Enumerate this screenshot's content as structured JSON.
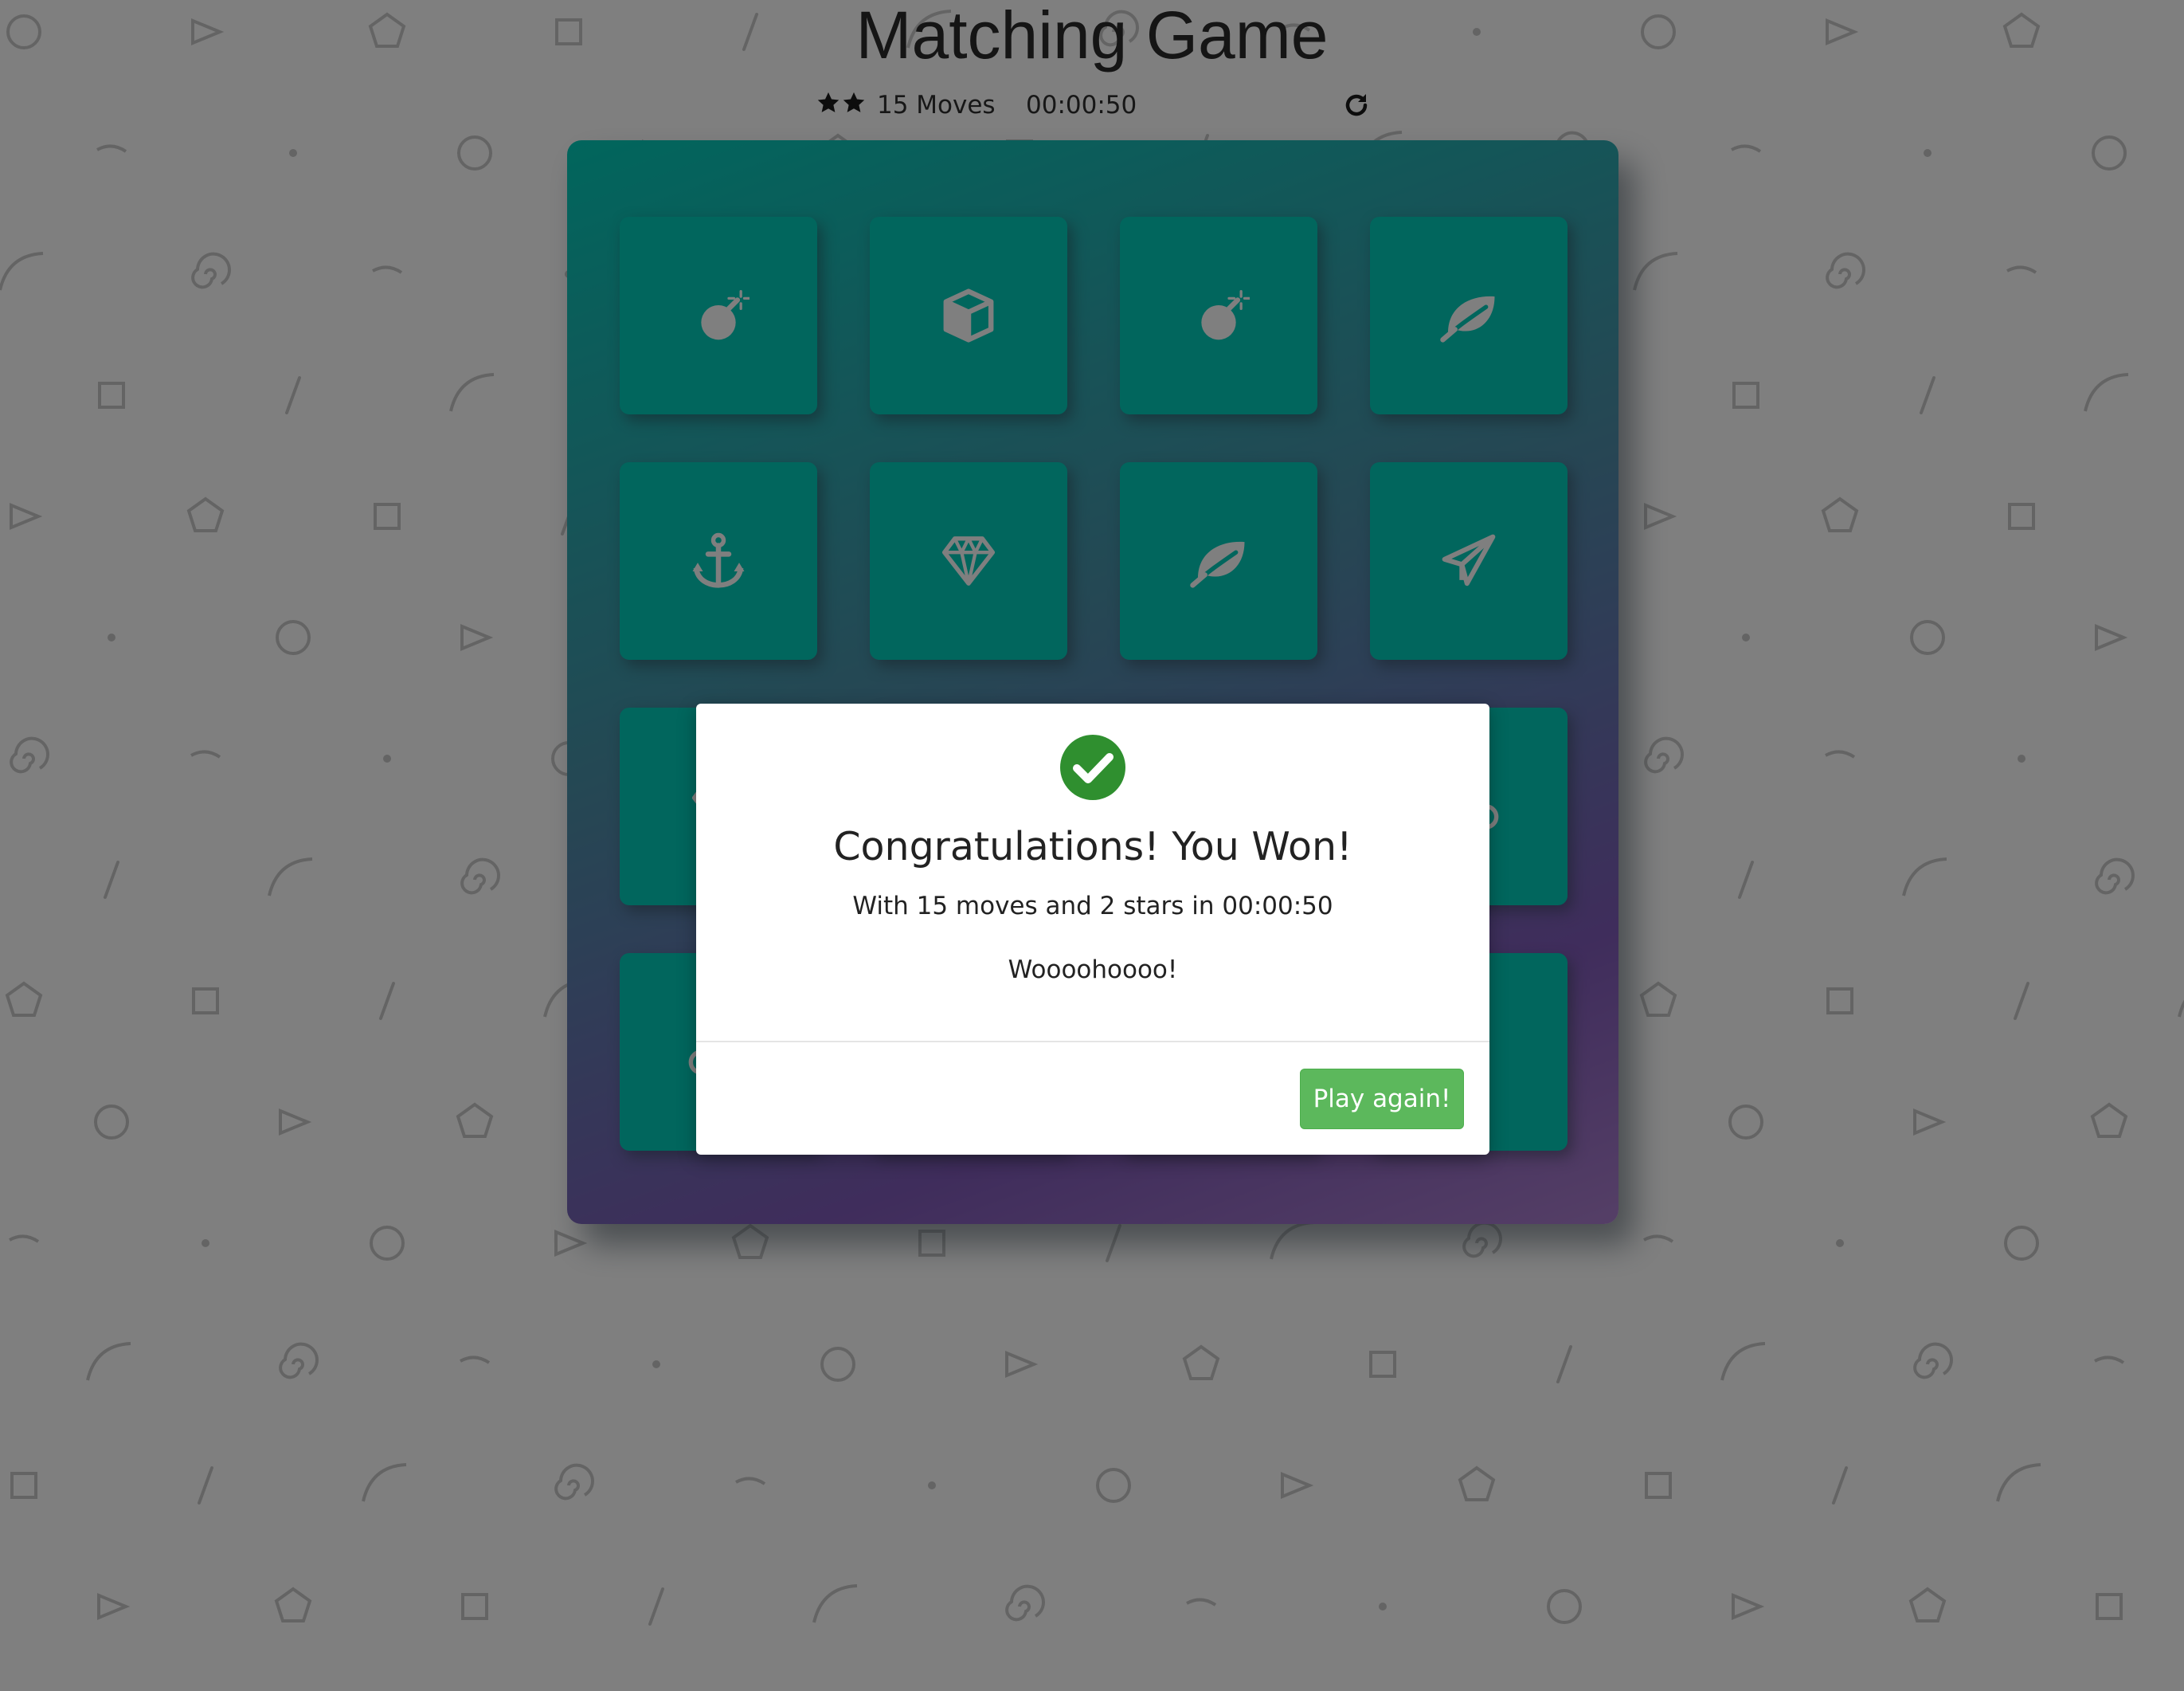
{
  "page": {
    "title": "Matching Game"
  },
  "score_panel": {
    "stars": 2,
    "star_icon": "star-icon",
    "moves_label": "15 Moves",
    "timer": "00:00:50",
    "restart_icon": "repeat-icon"
  },
  "deck": {
    "colors": {
      "open": "#02b3e4",
      "match": "#02ccba"
    },
    "cards": [
      {
        "icon": "bomb-icon",
        "state": "match"
      },
      {
        "icon": "cube-icon",
        "state": "match"
      },
      {
        "icon": "bomb-icon",
        "state": "match"
      },
      {
        "icon": "leaf-icon",
        "state": "match"
      },
      {
        "icon": "anchor-icon",
        "state": "match"
      },
      {
        "icon": "diamond-icon",
        "state": "match"
      },
      {
        "icon": "leaf-icon",
        "state": "match"
      },
      {
        "icon": "paper-plane-icon",
        "state": "match"
      },
      {
        "icon": "diamond-icon",
        "state": "match"
      },
      {
        "icon": "hidden-card",
        "state": "match"
      },
      {
        "icon": "hidden-card",
        "state": "match"
      },
      {
        "icon": "bicycle-icon",
        "state": "match"
      },
      {
        "icon": "bicycle-icon",
        "state": "match"
      },
      {
        "icon": "hidden-card",
        "state": "match"
      },
      {
        "icon": "hidden-card",
        "state": "match"
      },
      {
        "icon": "hidden-card",
        "state": "match"
      }
    ]
  },
  "modal": {
    "icon": "check-circle-icon",
    "title": "Congratulations! You Won!",
    "stats": "With 15 moves and 2 stars in 00:00:50",
    "cheer": "Woooohoooo!",
    "button_label": "Play again!",
    "colors": {
      "success": "#5cb85c",
      "check": "#2f8f2f"
    }
  }
}
